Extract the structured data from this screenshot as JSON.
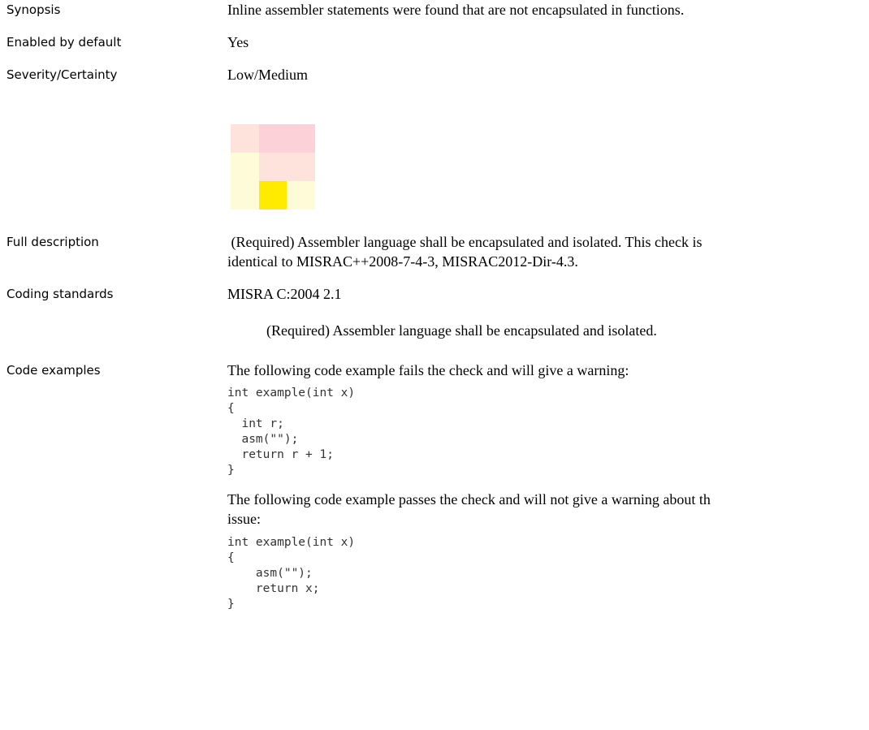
{
  "rows": {
    "synopsis": {
      "label": "Synopsis",
      "value": "Inline assembler statements were found that are not encapsulated in functions."
    },
    "enabled": {
      "label": "Enabled by default",
      "value": "Yes"
    },
    "severity": {
      "label": "Severity/Certainty",
      "value": "Low/Medium",
      "matrix_colors": [
        [
          "#fde3dc",
          "#fcd2d8",
          "#fcd2d8"
        ],
        [
          "#fdfbd8",
          "#fde3dc",
          "#fde3dc"
        ],
        [
          "#fdfbd8",
          "#ffeb00",
          "#fdfbd8"
        ]
      ]
    },
    "full_description": {
      "label": "Full description",
      "line1": " (Required) Assembler language shall be encapsulated and isolated. This check is",
      "line2": "identical to MISRAC++2008-7-4-3, MISRAC2012-Dir-4.3."
    },
    "coding_standards": {
      "label": "Coding standards",
      "standard": "MISRA C:2004 2.1",
      "rule_text": "(Required) Assembler language shall be encapsulated and isolated."
    },
    "code_examples": {
      "label": "Code examples",
      "fail_intro": "The following code example fails the check and will give a warning:",
      "fail_code": "int example(int x)\n{\n  int r;\n  asm(\"\");\n  return r + 1;\n}",
      "pass_intro_line1": "The following code example passes the check and will not give a warning about th",
      "pass_intro_line2": "issue:",
      "pass_code": "int example(int x)\n{\n    asm(\"\");\n    return x;\n}"
    }
  }
}
